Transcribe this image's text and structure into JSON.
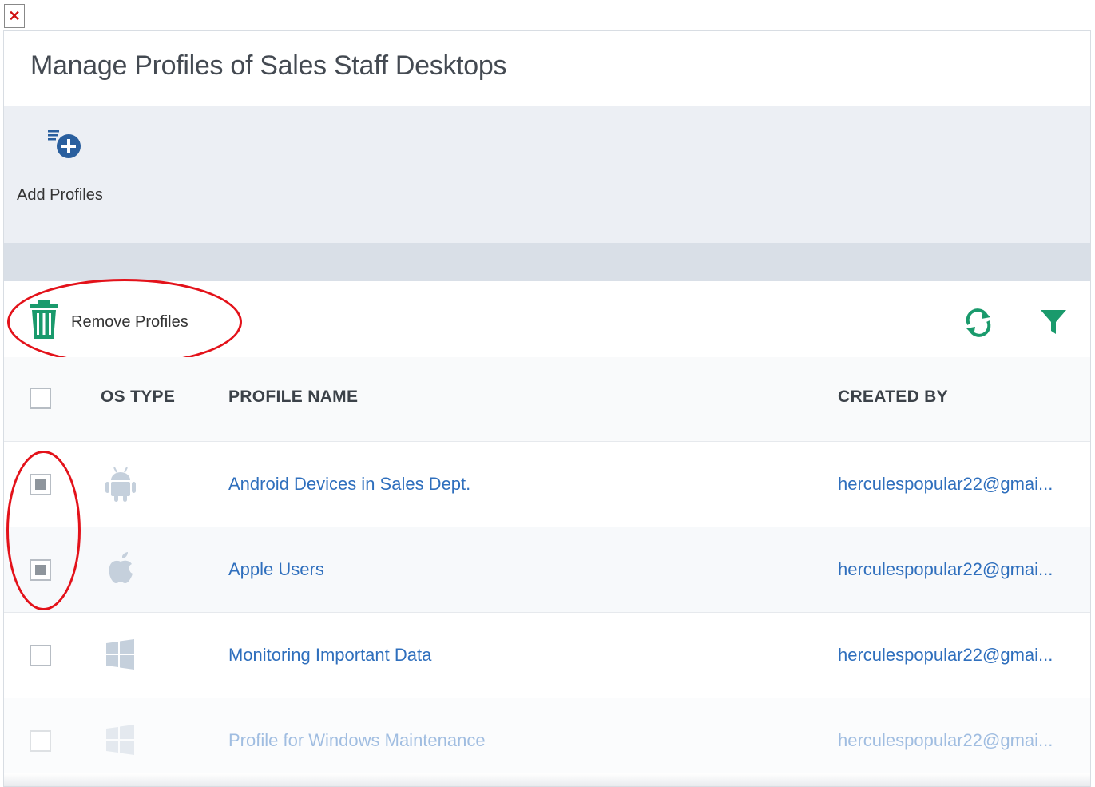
{
  "window": {
    "close_glyph": "✕"
  },
  "dialog": {
    "title": "Manage Profiles of Sales Staff Desktops"
  },
  "toolbar": {
    "add_profiles_label": "Add Profiles",
    "add_profiles_icon": "add-list-icon"
  },
  "actions": {
    "remove_profiles_label": "Remove Profiles",
    "remove_icon": "trash-icon",
    "refresh_icon": "refresh-icon",
    "filter_icon": "filter-icon"
  },
  "table": {
    "columns": {
      "os_type": "OS TYPE",
      "profile_name": "PROFILE NAME",
      "created_by": "CREATED BY"
    },
    "rows": [
      {
        "os": "android-icon",
        "name": "Android Devices in Sales Dept.",
        "created_by": "herculespopular22@gmai...",
        "checked": true
      },
      {
        "os": "apple-icon",
        "name": "Apple Users",
        "created_by": "herculespopular22@gmai...",
        "checked": true
      },
      {
        "os": "windows-icon",
        "name": "Monitoring Important Data",
        "created_by": "herculespopular22@gmai...",
        "checked": false
      },
      {
        "os": "windows-icon",
        "name": "Profile for Windows Maintenance",
        "created_by": "herculespopular22@gmai...",
        "checked": false
      }
    ]
  },
  "colors": {
    "accent_green": "#1a9a6c",
    "link_blue": "#2f6fbd",
    "annotation_red": "#e3121a",
    "toolbar_bg": "#eceff4"
  }
}
